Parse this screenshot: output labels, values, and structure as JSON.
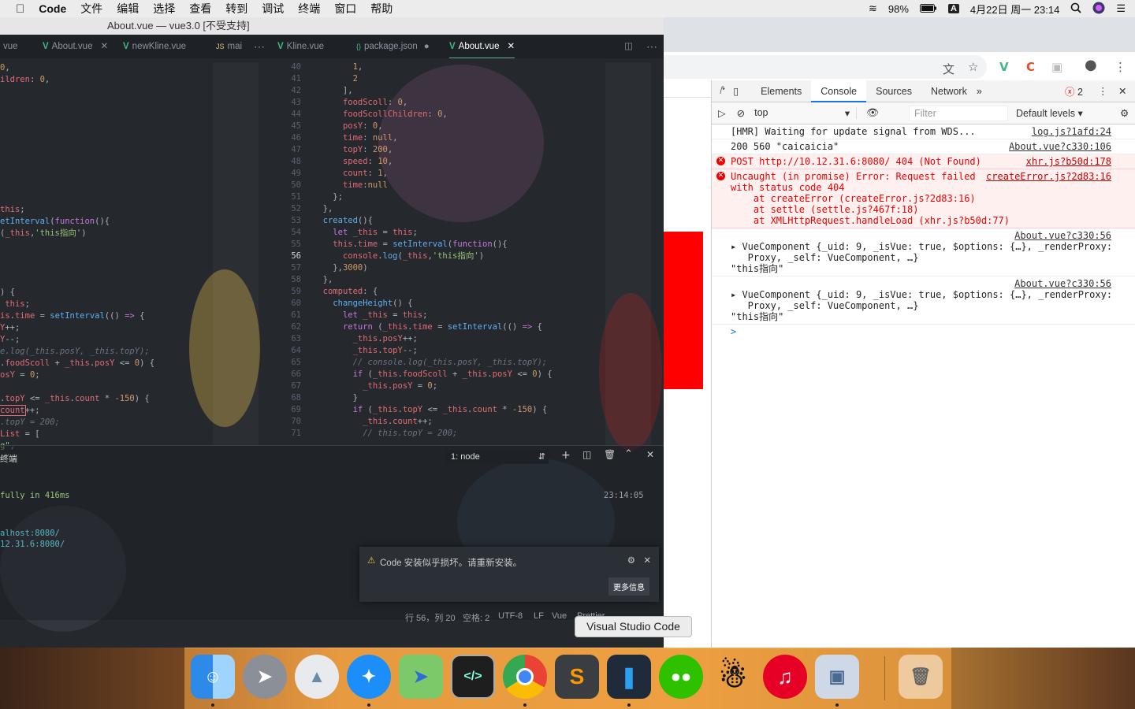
{
  "menubar": {
    "app": "Code",
    "items": [
      "文件",
      "编辑",
      "选择",
      "查看",
      "转到",
      "调试",
      "终端",
      "窗口",
      "帮助"
    ],
    "battery": "98%",
    "input_method": "A",
    "datetime": "4月22日 周一  23:14"
  },
  "vscode": {
    "window_title": "About.vue — vue3.0 [不受支持]",
    "tabs_left": [
      {
        "label": "vue",
        "icon": ""
      },
      {
        "label": "About.vue",
        "icon": "V"
      },
      {
        "label": "newKline.vue",
        "icon": "V"
      },
      {
        "label": "mai",
        "icon": "JS"
      }
    ],
    "tabs_right": [
      {
        "label": "Kline.vue",
        "icon": "V"
      },
      {
        "label": "package.json",
        "icon": "{}"
      },
      {
        "label": "About.vue",
        "icon": "V"
      }
    ],
    "line_numbers": [
      "40",
      "41",
      "42",
      "43",
      "44",
      "45",
      "46",
      "47",
      "48",
      "49",
      "50",
      "51",
      "52",
      "53",
      "54",
      "55",
      "56",
      "57",
      "58",
      "59",
      "60",
      "61",
      "62",
      "63",
      "64",
      "65",
      "66",
      "67",
      "68",
      "69",
      "70",
      "71"
    ],
    "terminal": {
      "label": "终端",
      "select": "1: node",
      "line1": "fully in 416ms",
      "time": "23:14:05",
      "url1": "alhost:8080/",
      "url2": "12.31.6:8080/"
    },
    "notification": {
      "text": "Code 安装似乎损坏。请重新安装。",
      "button": "更多信息"
    },
    "status": {
      "position": "行 56，列 20",
      "spaces": "空格: 2",
      "encoding": "UTF-8",
      "eol": "LF",
      "language": "Vue",
      "formatter": "Prettier"
    }
  },
  "tooltip": "Visual Studio Code",
  "devtools": {
    "tabs": [
      "Elements",
      "Console",
      "Sources",
      "Network"
    ],
    "active_tab": "Console",
    "error_count": "2",
    "context": "top",
    "filter_placeholder": "Filter",
    "levels": "Default levels",
    "logs": [
      {
        "text": "[HMR] Waiting for update signal from WDS...",
        "src": "log.js?1afd:24",
        "type": "log"
      },
      {
        "text": "200 560 \"caicaicia\"",
        "src": "About.vue?c330:106",
        "type": "log"
      },
      {
        "text": "POST http://10.12.31.6:8080/ 404 (Not Found)",
        "src": "xhr.js?b50d:178",
        "type": "error"
      },
      {
        "text": "Uncaught (in promise) Error: Request failed\nwith status code 404\n    at createError (createError.js?2d83:16)\n    at settle (settle.js?467f:18)\n    at XMLHttpRequest.handleLoad (xhr.js?b50d:77)",
        "src": "createError.js?2d83:16",
        "type": "error"
      },
      {
        "text": "\n▸ VueComponent {_uid: 9, _isVue: true, $options: {…}, _renderProxy:\n   Proxy, _self: VueComponent, …}\n\"this指向\"",
        "src": "About.vue?c330:56",
        "type": "log"
      },
      {
        "text": "\n▸ VueComponent {_uid: 9, _isVue: true, $options: {…}, _renderProxy:\n   Proxy, _self: VueComponent, …}\n\"this指向\"",
        "src": "About.vue?c330:56",
        "type": "log"
      }
    ],
    "prompt": ">"
  },
  "dock": {
    "apps": [
      "Finder",
      "Launchpad",
      "Alfred",
      "Safari",
      "Maps",
      "Terminal",
      "Chrome",
      "Sublime Text",
      "Visual Studio Code",
      "WeChat",
      "QQ",
      "NetEase Music",
      "Preview",
      "Trash"
    ]
  }
}
